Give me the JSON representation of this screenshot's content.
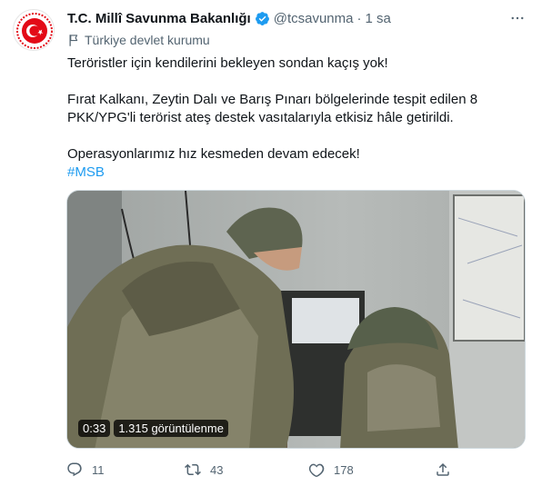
{
  "account": {
    "display_name": "T.C. Millî Savunma Bakanlığı",
    "handle": "@tcsavunma",
    "separator": "·",
    "time": "1 sa",
    "affiliation": "Türkiye devlet kurumu",
    "verified_icon": "verified-badge-icon",
    "more_icon": "more-options-icon"
  },
  "tweet": {
    "line1": "Teröristler için kendilerini bekleyen sondan kaçış yok!",
    "line2a": "Fırat Kalkanı, Zeytin Dalı ve Barış Pınarı bölgelerinde tespit edilen 8",
    "line2b": "PKK/YPG'li terörist ateş destek vasıtalarıyla etkisiz hâle getirildi.",
    "line3": "Operasyonlarımız hız kesmeden devam edecek!",
    "hashtag": "#MSB"
  },
  "media": {
    "duration": "0:33",
    "views": "1.315 görüntülenme"
  },
  "actions": {
    "reply_count": "11",
    "retweet_count": "43",
    "like_count": "178"
  },
  "colors": {
    "link": "#1d9bf0",
    "secondary_text": "#536471",
    "primary_text": "#0f1419",
    "logo_red": "#e30a17"
  }
}
